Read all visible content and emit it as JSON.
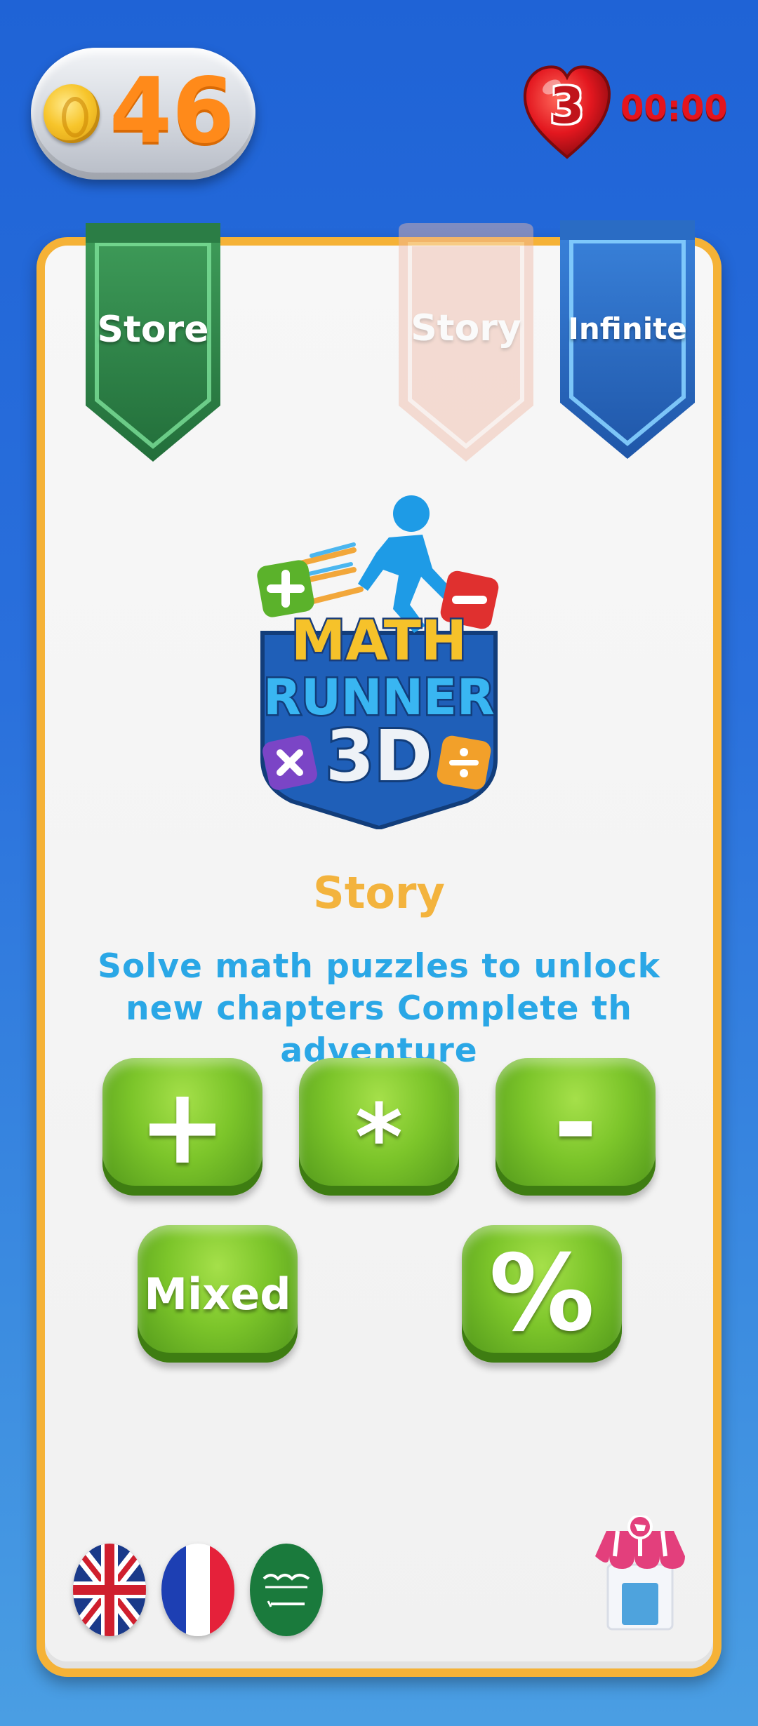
{
  "hud": {
    "coins": "46",
    "lives": "3",
    "timer": "00:00"
  },
  "tabs": {
    "store": "Store",
    "story": "Story",
    "infinite": "Infinite"
  },
  "mode": {
    "title": "Story",
    "description": "Solve math puzzles to unlock new chapters Complete th adventure"
  },
  "operations": {
    "add": "+",
    "multiply": "*",
    "subtract": "-",
    "mixed": "Mixed",
    "percent": "%"
  },
  "logo": {
    "line1": "MATH",
    "line2": "RUNNER",
    "line3": "3D"
  },
  "languages": [
    "english-flag",
    "french-flag",
    "saudi-flag"
  ],
  "colors": {
    "accent": "#f5b237",
    "button_green": "#7cc52a",
    "description_blue": "#2aa7e6",
    "store_green": "#2f8a4a",
    "infinite_blue": "#2f6fc8",
    "timer_red": "#e5141c",
    "coin_orange": "#ff8a1a"
  }
}
